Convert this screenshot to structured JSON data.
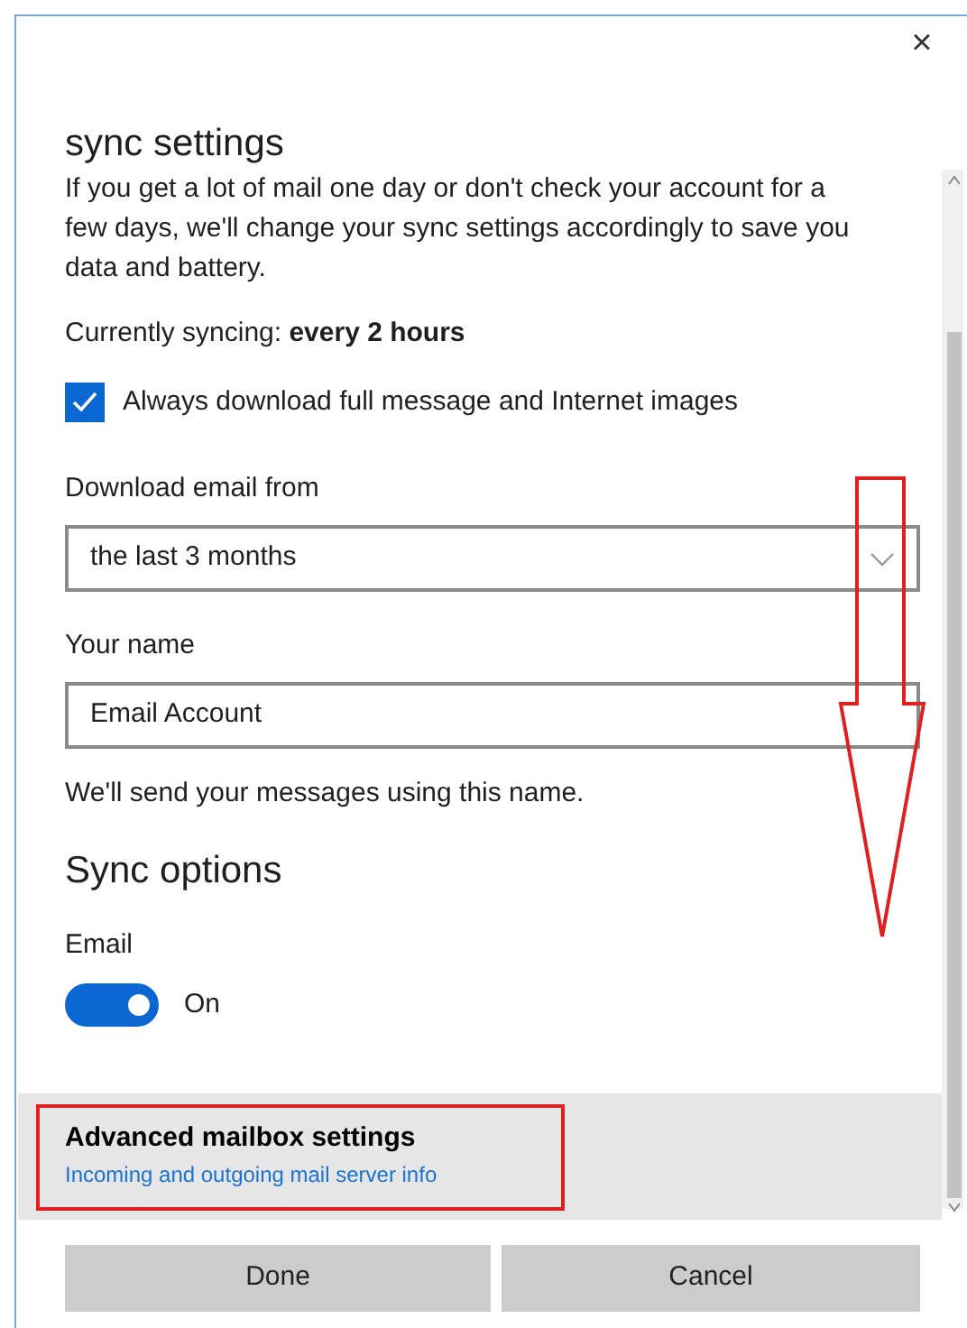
{
  "dialog": {
    "close": "×"
  },
  "sync_settings": {
    "heading": "sync settings",
    "description": "If you get a lot of mail one day or don't check your account for a few days, we'll change your sync settings accordingly to save you data and battery.",
    "status": "Currently syncing: **every 2 hours**"
  },
  "full_download": {
    "label": "Always download full message and Internet images",
    "checked": true
  },
  "download_from": {
    "label": "Download email from",
    "value": "the last 3 months"
  },
  "your_name": {
    "label": "Your name",
    "value": "Email Account",
    "help": "We'll send your messages using this name."
  },
  "sync_options": {
    "heading": "Sync options",
    "items": [
      {
        "label": "Email",
        "on": true,
        "state": "On"
      }
    ]
  },
  "advanced": {
    "title": "Advanced mailbox settings",
    "link": "Incoming and outgoing mail server info"
  },
  "buttons": [
    {
      "label": "Done"
    },
    {
      "label": "Cancel"
    }
  ]
}
